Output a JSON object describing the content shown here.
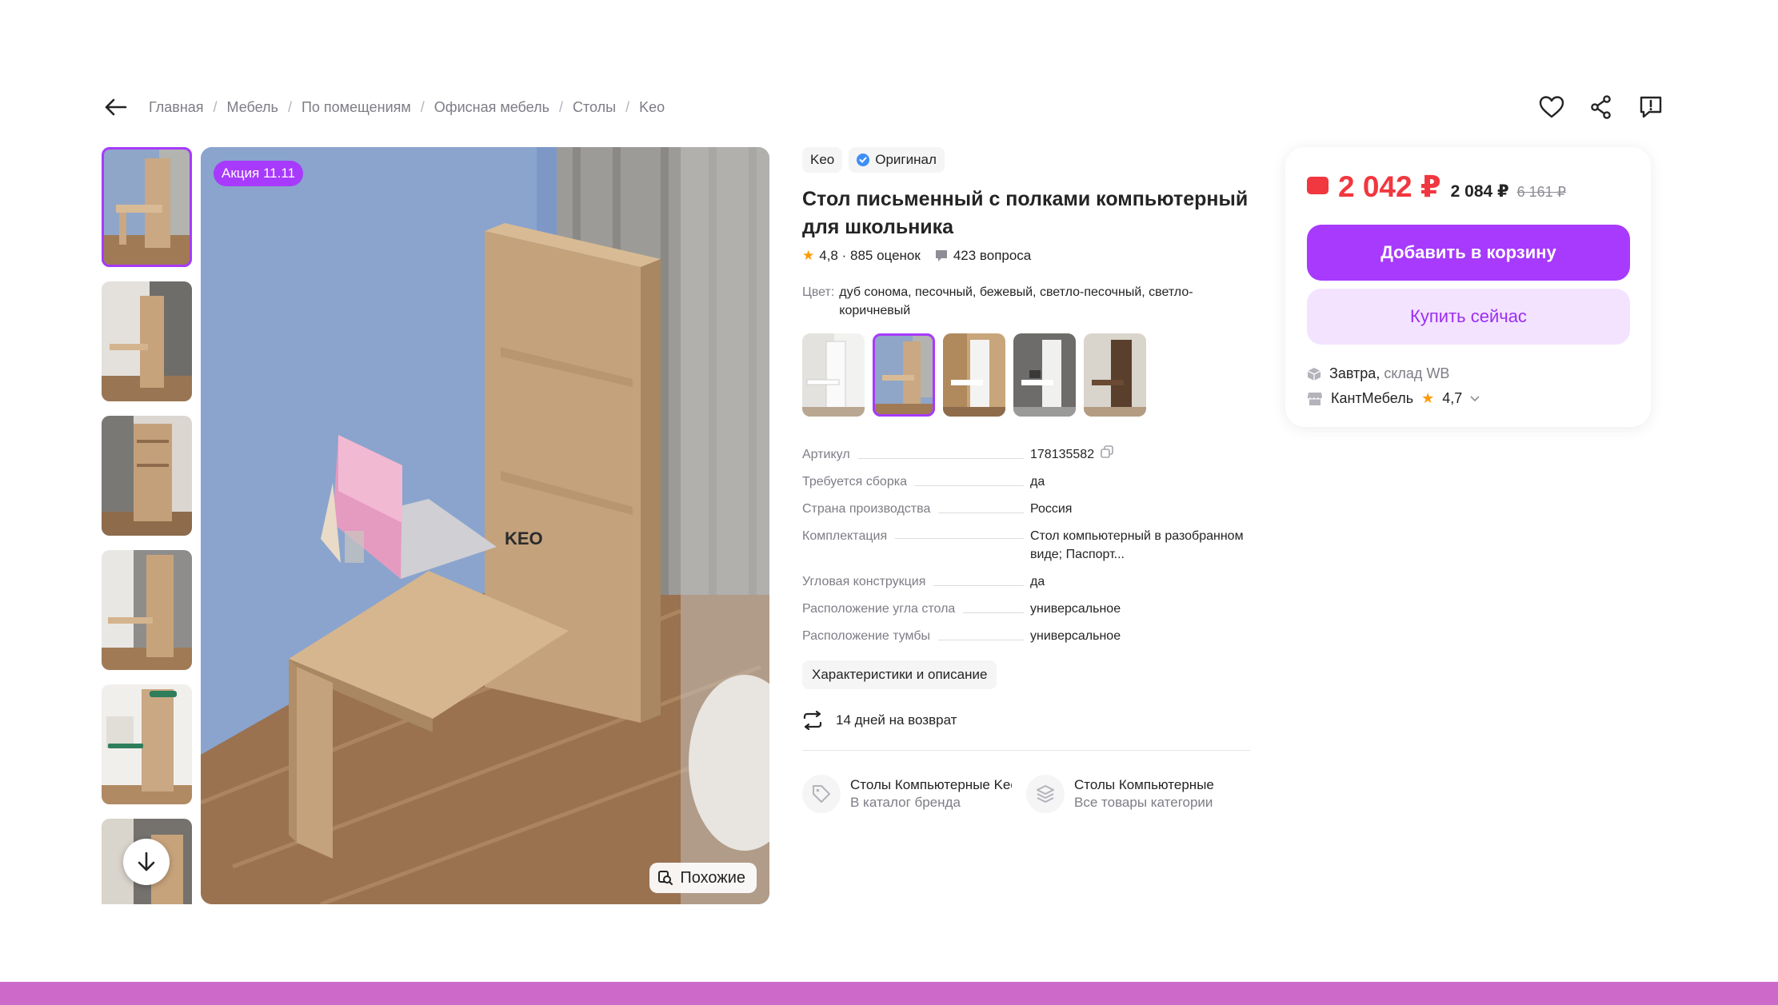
{
  "breadcrumbs": [
    "Главная",
    "Мебель",
    "По помещениям",
    "Офисная мебель",
    "Столы",
    "Keo"
  ],
  "gallery": {
    "promo": "Акция 11.11",
    "similar_label": "Похожие",
    "thumb_count": 6
  },
  "product": {
    "brand": "Keo",
    "original_label": "Оригинал",
    "title": "Стол письменный с полками компьютерный для школьника",
    "rating_text": "4,8 · 885 оценок",
    "questions": "423 вопроса",
    "color_label": "Цвет:",
    "color_value": "дуб сонома, песочный, бежевый, светло-песочный, светло-коричневый",
    "specs": [
      {
        "name": "Артикул",
        "value": "178135582"
      },
      {
        "name": "Требуется сборка",
        "value": "да"
      },
      {
        "name": "Страна производства",
        "value": "Россия"
      },
      {
        "name": "Комплектация",
        "value": "Стол компьютерный в разобранном виде; Паспорт..."
      },
      {
        "name": "Угловая конструкция",
        "value": "да"
      },
      {
        "name": "Расположение угла стола",
        "value": "универсальное"
      },
      {
        "name": "Расположение тумбы",
        "value": "универсальное"
      }
    ],
    "desc_button": "Характеристики и описание",
    "return_text": "14 дней на возврат",
    "links": [
      {
        "title": "Столы Компьютерные Keo",
        "sub": "В каталог бренда"
      },
      {
        "title": "Столы Компьютерные",
        "sub": "Все товары категории"
      }
    ]
  },
  "buy": {
    "price": "2 042 ₽",
    "price_secondary": "2 084 ₽",
    "price_old": "6 161 ₽",
    "add_to_cart": "Добавить в корзину",
    "buy_now": "Купить сейчас",
    "delivery_day": "Завтра,",
    "delivery_from": "склад WB",
    "seller": "КантМебель",
    "seller_rating": "4,7"
  },
  "colors": {
    "accent": "#a73afd",
    "price": "#f1373f",
    "rating_star": "#ff9a00",
    "band": "#cd6ac9"
  }
}
